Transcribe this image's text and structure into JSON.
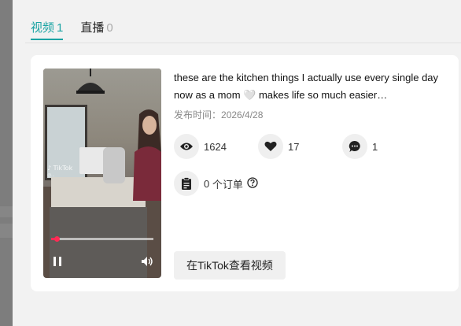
{
  "tabs": [
    {
      "label": "视频",
      "count": "1",
      "active": true
    },
    {
      "label": "直播",
      "count": "0",
      "active": false
    }
  ],
  "video": {
    "watermark": "TikTok",
    "watermark_handle": "@...",
    "progress": 0.05,
    "pause_icon": "pause-icon",
    "volume_icon": "volume-icon"
  },
  "post": {
    "title": "these are the kitchen things I actually use every single day now as a mom 🤍 makes life so much easier…",
    "date_label": "发布时间：",
    "date": "2026/4/28"
  },
  "stats": {
    "views": {
      "icon": "eye-icon",
      "value": "1624"
    },
    "likes": {
      "icon": "heart-icon",
      "value": "17"
    },
    "comments": {
      "icon": "comment-icon",
      "value": "1"
    },
    "orders": {
      "icon": "clipboard-icon",
      "value": "0",
      "label": "个订单",
      "help_icon": "question-icon"
    }
  },
  "actions": {
    "view_on_tiktok": "在TikTok查看视频"
  },
  "colors": {
    "accent": "#1aa3a3",
    "progress": "#ff2b55"
  }
}
